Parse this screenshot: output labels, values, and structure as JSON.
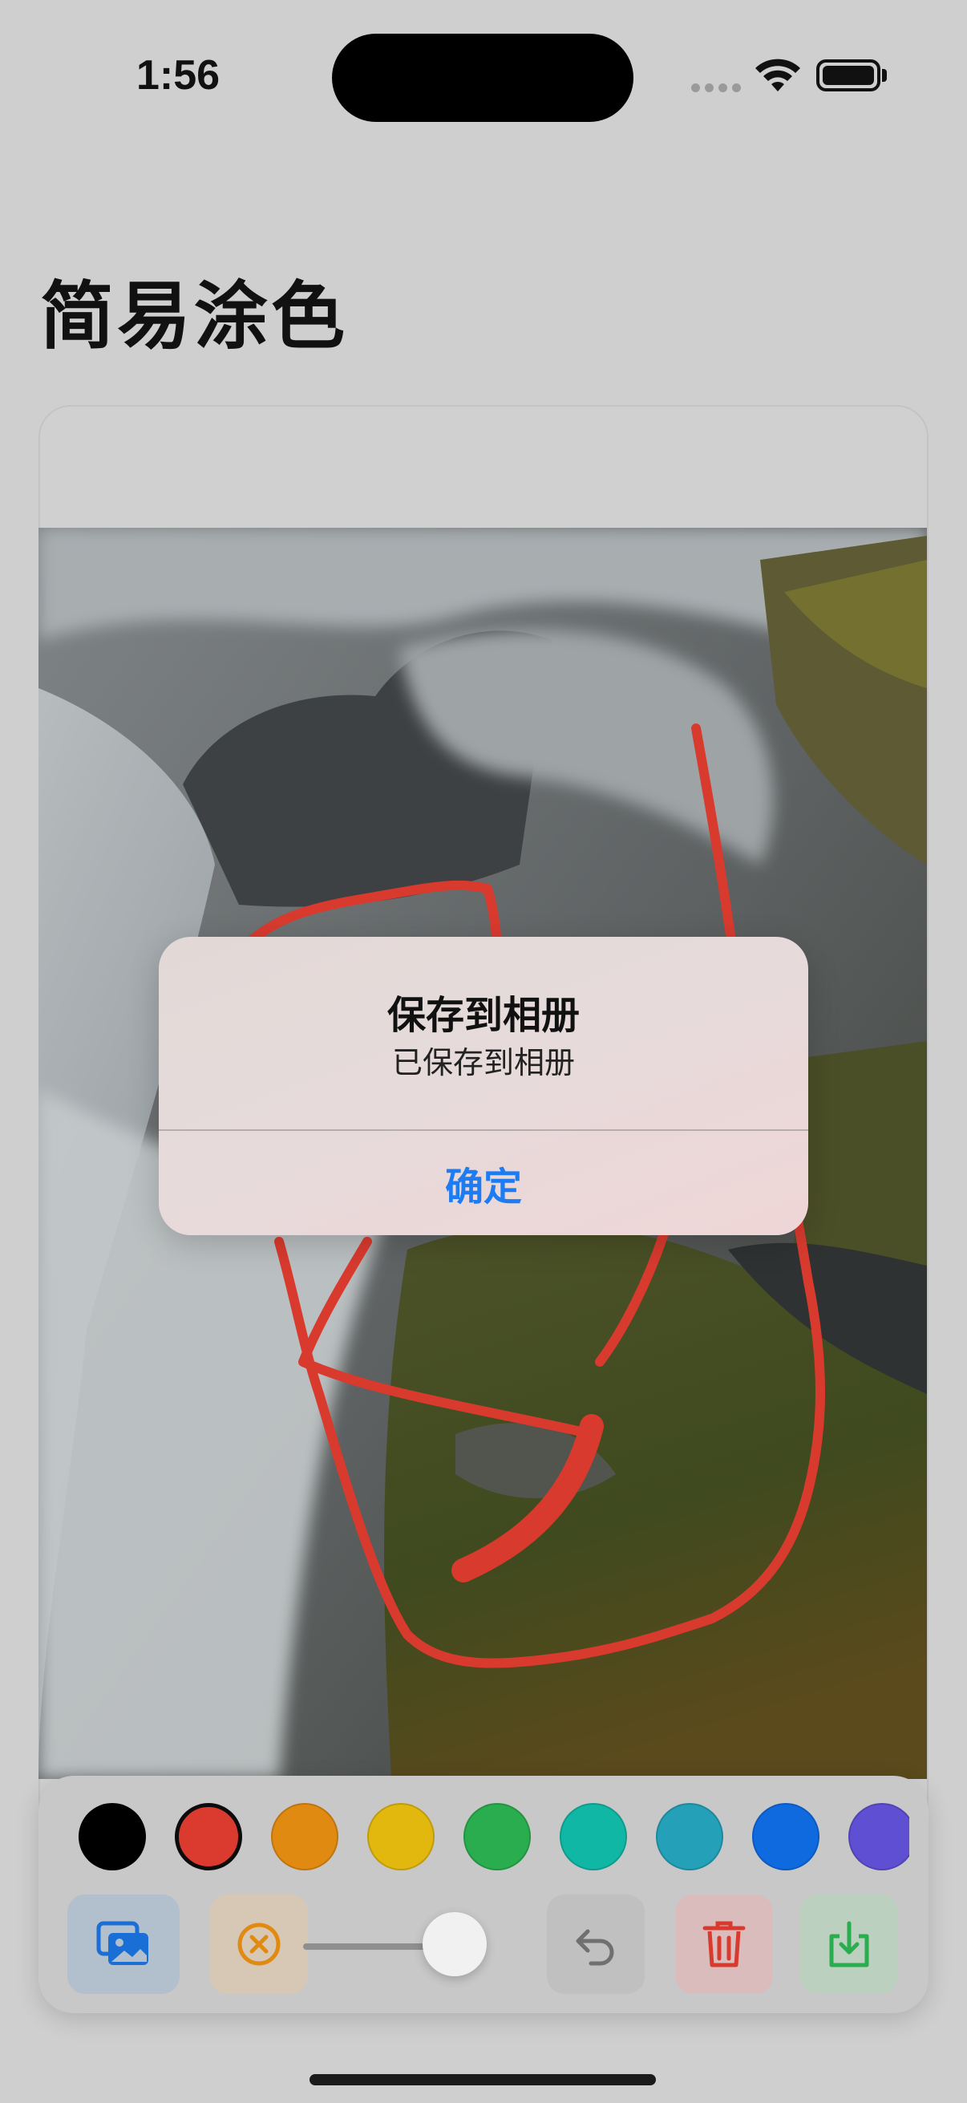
{
  "status_bar": {
    "time": "1:56"
  },
  "page": {
    "title": "简易涂色"
  },
  "palette": {
    "colors": [
      "#000000",
      "#db3a2f",
      "#e08a12",
      "#e2b80f",
      "#2aad4e",
      "#11b7a5",
      "#24a0b8",
      "#0f6ae0",
      "#5f4fd2"
    ],
    "selected_index": 1
  },
  "toolbar": {
    "photo_icon": "photo-library-icon",
    "clear_icon": "clear-circle-x-icon",
    "undo_icon": "undo-icon",
    "trash_icon": "trash-icon",
    "save_icon": "save-download-icon",
    "brush_size_fraction": 0.7
  },
  "alert": {
    "title": "保存到相册",
    "message": "已保存到相册",
    "confirm_label": "确定"
  },
  "colors": {
    "accent": "#1d7cf2",
    "stroke": "#d93a2e"
  }
}
